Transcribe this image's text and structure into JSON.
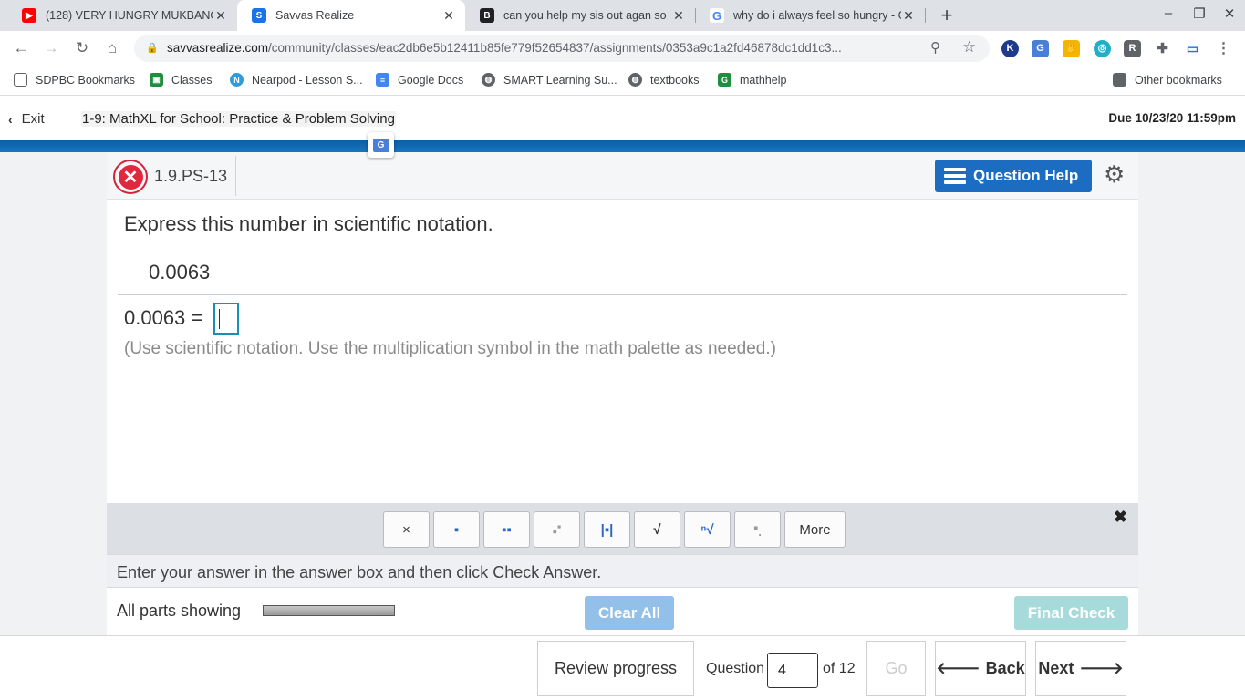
{
  "browser": {
    "tabs": [
      {
        "title": "(128) VERY HUNGRY MUKBANG!",
        "favicon": "youtube-icon",
        "color": "#ff0000"
      },
      {
        "title": "Savvas Realize",
        "favicon": "savvas-icon",
        "color": "#1a73e8"
      },
      {
        "title": "can you help my sis out agan so",
        "favicon": "brainly-icon",
        "color": "#202124"
      },
      {
        "title": "why do i always feel so hungry - G",
        "favicon": "google-icon",
        "color": "#4285f4"
      }
    ],
    "url_host": "savvasrealize.com",
    "url_path": "/community/classes/eac2db6e5b12411b85fe779f52654837/assignments/0353a9c1a2fd46878dc1dd1c3...",
    "bookmarks": [
      {
        "label": "SDPBC Bookmarks",
        "icon": "folder-icon"
      },
      {
        "label": "Classes",
        "icon": "classroom-icon"
      },
      {
        "label": "Nearpod - Lesson S...",
        "icon": "nearpod-icon"
      },
      {
        "label": "Google Docs",
        "icon": "docs-icon"
      },
      {
        "label": "SMART Learning Su...",
        "icon": "globe-icon"
      },
      {
        "label": "textbooks",
        "icon": "globe-icon"
      },
      {
        "label": "mathhelp",
        "icon": "mathhelp-icon"
      }
    ],
    "other_bookmarks": "Other bookmarks"
  },
  "header": {
    "exit_label": "Exit",
    "assignment_title": "1-9: MathXL for School: Practice & Problem Solving",
    "due": "Due 10/23/20 11:59pm"
  },
  "question": {
    "id": "1.9.PS-13",
    "help_label": "Question Help",
    "prompt": "Express this number in scientific notation.",
    "number": "0.0063",
    "equation_lhs": "0.0063 =",
    "hint": "(Use scientific notation. Use the multiplication symbol in the math palette as needed.)"
  },
  "palette": {
    "buttons": [
      "×",
      "fraction",
      "mixed-number",
      "exponent",
      "absolute-value",
      "√",
      "nth-root",
      "subscript"
    ],
    "more_label": "More"
  },
  "instruction": "Enter your answer in the answer box and then click Check Answer.",
  "status": {
    "parts_label": "All parts showing",
    "clear_all": "Clear All",
    "final_check": "Final Check"
  },
  "footer": {
    "review_progress": "Review progress",
    "question_label": "Question",
    "question_number": "4",
    "of_total": "of 12",
    "go_label": "Go",
    "back_label": "Back",
    "next_label": "Next"
  }
}
